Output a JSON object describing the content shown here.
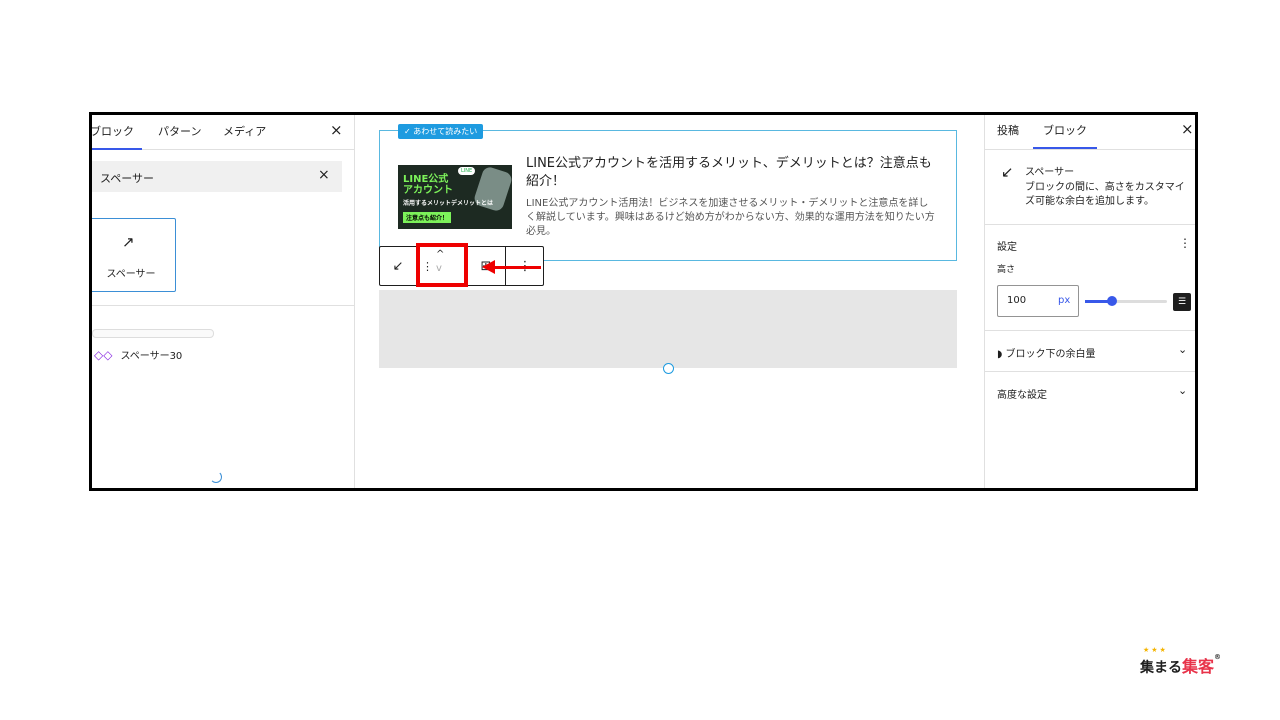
{
  "left_panel": {
    "tabs": [
      "ブロック",
      "パターン",
      "メディア"
    ],
    "close": "×",
    "search_value": "スペーサー",
    "search_clear": "×",
    "block_result": {
      "icon": "↗",
      "label": "スペーサー"
    },
    "pattern_item": {
      "icon": "◇◇",
      "label": "スペーサー30"
    }
  },
  "editor": {
    "related": {
      "badge": "✓ あわせて読みたい",
      "thumb_title": "LINE公式\nアカウント",
      "thumb_sub": "活用するメリットデメリットとは",
      "thumb_tag": "注意点も紹介！",
      "thumb_badge": "LINE",
      "title": "LINE公式アカウントを活用するメリット、デメリットとは？注意点も紹介！",
      "description": "LINE公式アカウント活用法！ビジネスを加速させるメリット・デメリットと注意点を詳しく解説しています。興味はあるけど始め方がわからない方、効果的な運用方法を知りたい方必見。"
    },
    "toolbar": {
      "block_icon": "↙",
      "drag": "⋮",
      "move_up": "^",
      "move_down": "v",
      "align": "⊞",
      "more": "⋮"
    }
  },
  "right_panel": {
    "tabs": [
      "投稿",
      "ブロック"
    ],
    "close": "×",
    "block_icon": "↙",
    "block_name": "スペーサー",
    "block_desc": "ブロックの間に、高さをカスタマイズ可能な余白を追加します。",
    "settings_title": "設定",
    "settings_menu": "⋮",
    "height_label": "高さ",
    "height_value": "100",
    "height_unit": "px",
    "slider_fraction": 0.3,
    "custom_icon": "☰",
    "margin_panel": "◗ ブロック下の余白量",
    "advanced_panel": "高度な設定",
    "chevron": "⌄"
  },
  "logo": {
    "stars": "★★★",
    "text1": "集まる",
    "text2": "集客",
    "reg": "®"
  }
}
